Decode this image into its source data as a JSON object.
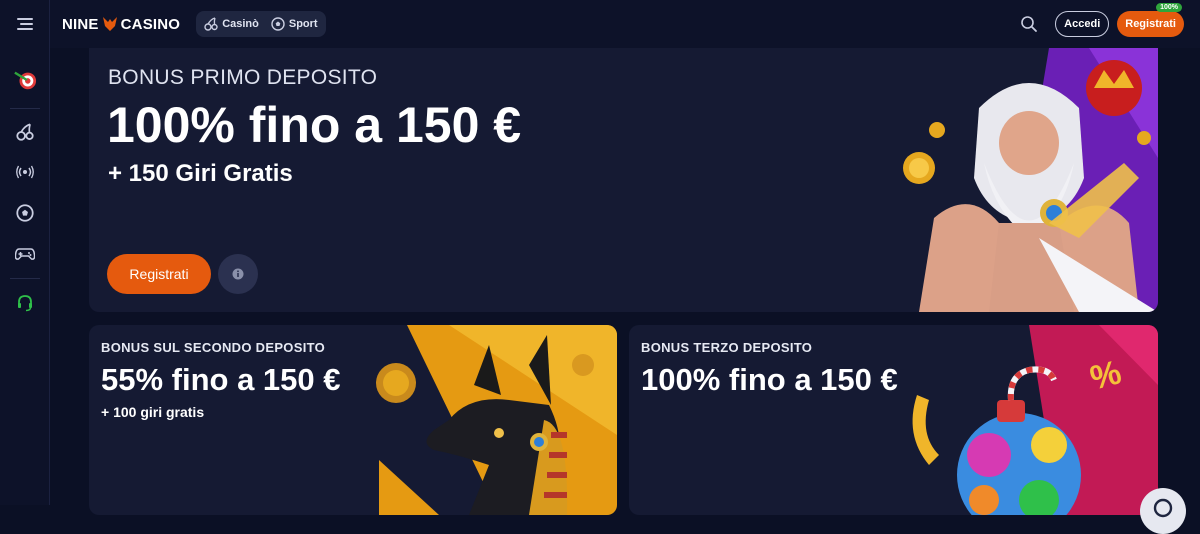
{
  "brand": {
    "name_left": "NINE",
    "name_right": "CASINO",
    "accent": "#e55a0e"
  },
  "nav": {
    "items": [
      {
        "label": "Casinò",
        "icon": "cherry-icon"
      },
      {
        "label": "Sport",
        "icon": "soccer-ball-icon"
      }
    ]
  },
  "header": {
    "login_label": "Accedi",
    "register_label": "Registrati",
    "register_badge": "100%"
  },
  "sidebar": {
    "items": [
      {
        "icon": "darts-target-icon"
      },
      {
        "icon": "cherry-icon"
      },
      {
        "icon": "live-broadcast-icon"
      },
      {
        "icon": "soccer-ball-icon"
      },
      {
        "icon": "gamepad-icon"
      },
      {
        "icon": "support-headset-icon"
      }
    ]
  },
  "hero": {
    "subtitle": "BONUS PRIMO DEPOSITO",
    "title": "100% fino a 150 €",
    "extra": "+ 150 Giri Gratis",
    "cta_label": "Registrati"
  },
  "promo_second": {
    "subtitle": "BONUS SUL SECONDO DEPOSITO",
    "title": "55% fino a 150 €",
    "extra": "+ 100 giri gratis"
  },
  "promo_third": {
    "subtitle": "BONUS TERZO DEPOSITO",
    "title": "100% fino a 150 €"
  }
}
